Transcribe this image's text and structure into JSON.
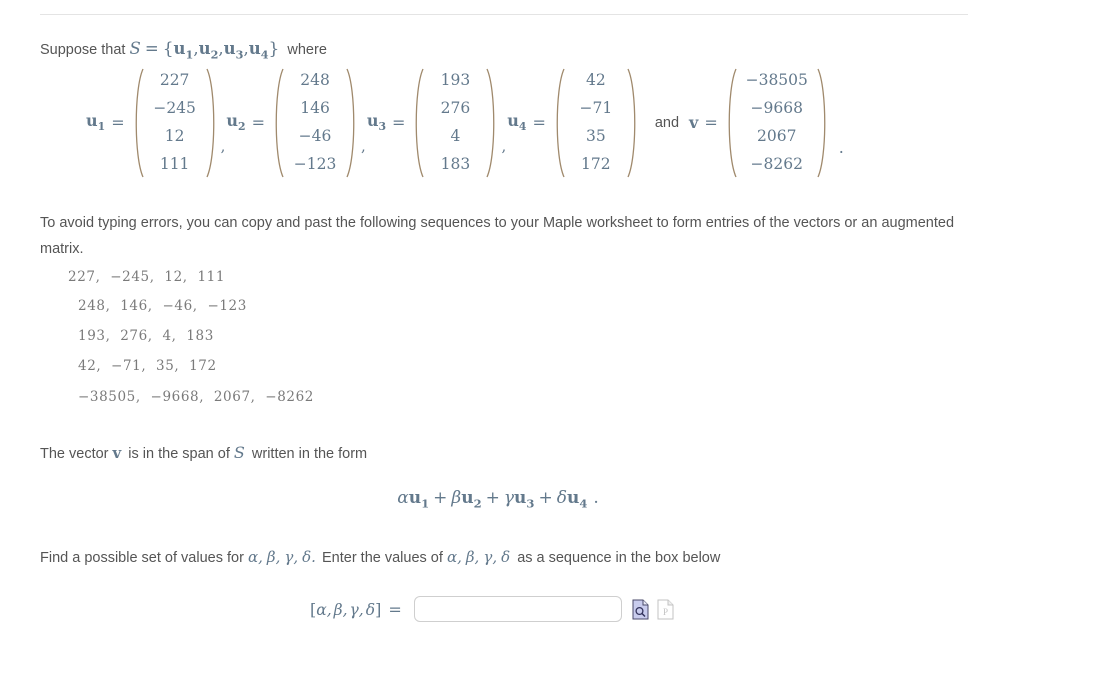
{
  "problem": {
    "suppose_prefix": "Suppose that",
    "set_name": "S",
    "equals": "=",
    "set_open": "{",
    "set_close": "}",
    "set_members": [
      "u",
      "u",
      "u",
      "u"
    ],
    "set_member_subs": [
      "1",
      "2",
      "3",
      "4"
    ],
    "where_word": "where"
  },
  "vectors": [
    {
      "name": "u",
      "sub": "1",
      "entries": [
        "227",
        "−245",
        "12",
        "111"
      ]
    },
    {
      "name": "u",
      "sub": "2",
      "entries": [
        "248",
        "146",
        "−46",
        "−123"
      ]
    },
    {
      "name": "u",
      "sub": "3",
      "entries": [
        "193",
        "276",
        "4",
        "183"
      ]
    },
    {
      "name": "u",
      "sub": "4",
      "entries": [
        "42",
        "−71",
        "35",
        "172"
      ]
    },
    {
      "name": "v",
      "sub": "",
      "entries": [
        "−38505",
        "−9668",
        "2067",
        "−8262"
      ]
    }
  ],
  "separators": {
    "comma": ",",
    "and": "and",
    "equals": "=",
    "period": "."
  },
  "instructions": {
    "text": " To avoid typing errors, you can copy and past the following sequences to your Maple worksheet to form entries of the vectors or an augmented matrix."
  },
  "sequences": [
    "227,  −245,  12,  111",
    "248,  146,  −46,  −123",
    "193,  276,  4,  183",
    "42,  −71,  35,  172",
    "−38505,  −9668,  2067,  −8262"
  ],
  "span_sentence": {
    "part1": "The vector",
    "vector_symbol": "v",
    "part2": "is in the span of",
    "set_symbol": "S",
    "part3": "written in the form"
  },
  "formula": {
    "terms": [
      {
        "coef": "α",
        "vec": "u",
        "sub": "1"
      },
      {
        "coef": "β",
        "vec": "u",
        "sub": "2"
      },
      {
        "coef": "γ",
        "vec": "u",
        "sub": "3"
      },
      {
        "coef": "δ",
        "vec": "u",
        "sub": "4"
      }
    ],
    "plus": "+",
    "period": "."
  },
  "find_sentence": {
    "part1": "Find a possible set of values for",
    "greeks1": [
      "α,",
      "β,",
      "γ,",
      "δ."
    ],
    "part2": "Enter the values of",
    "greeks2": [
      "α,",
      "β,",
      "γ,",
      "δ"
    ],
    "part3": "as a sequence in the box below"
  },
  "answer": {
    "label_open": "[",
    "label_greeks": [
      "α,",
      "β,",
      "γ,",
      "δ"
    ],
    "label_close": "]",
    "label_equals": "=",
    "input_value": "",
    "input_placeholder": ""
  },
  "icons": {
    "preview": "document-magnifier-icon",
    "palette": "document-palette-icon"
  },
  "colors": {
    "body_text": "#555555",
    "math_text": "#63798c",
    "paren": "#a08a6d",
    "sequence_text": "#7a7a7a",
    "rule": "#e4e4e4",
    "input_border": "#cfcfcf",
    "icon_active_fill": "#c9cced",
    "icon_disabled": "#cfcfcf"
  }
}
